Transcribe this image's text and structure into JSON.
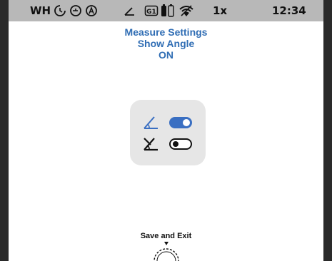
{
  "status_bar": {
    "profile": "WH",
    "zoom": "1x",
    "time": "12:34",
    "icons": [
      "moon-clock-icon",
      "timer-icon",
      "auto-icon",
      "angle-icon",
      "battery-badge-icon",
      "battery-icon",
      "wifi-icon"
    ],
    "badge_text": "G1"
  },
  "header": {
    "line1": "Measure Settings",
    "line2": "Show Angle",
    "line3": "ON"
  },
  "panel": {
    "options": [
      {
        "icon": "angle-icon",
        "state": "on"
      },
      {
        "icon": "no-angle-icon",
        "state": "off"
      }
    ]
  },
  "footer": {
    "save_label": "Save and Exit",
    "control_icon": "rotary-dial-icon"
  },
  "colors": {
    "accent": "#2f6db4",
    "status_bar_bg": "#b8b8b8",
    "panel_bg": "#e6e6e6",
    "bezel": "#2a2a2a"
  }
}
